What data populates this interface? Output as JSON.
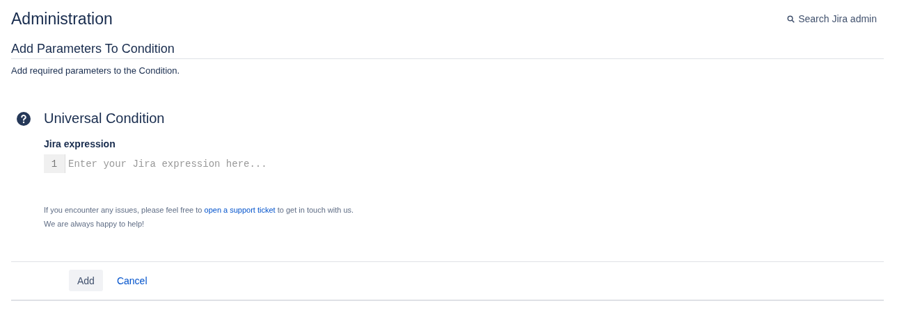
{
  "header": {
    "title": "Administration",
    "search_link": "Search Jira admin"
  },
  "section": {
    "title": "Add Parameters To Condition",
    "description": "Add required parameters to the Condition."
  },
  "condition": {
    "title": "Universal Condition",
    "field_label": "Jira expression",
    "editor": {
      "line_number": "1",
      "placeholder": "Enter your Jira expression here..."
    },
    "help": {
      "before": "If you encounter any issues, please feel free to ",
      "link": "open a support ticket",
      "after": " to get in touch with us.",
      "line_2": "We are always happy to help!"
    }
  },
  "buttons": [
    {
      "kind": "primary",
      "label": "Add"
    },
    {
      "kind": "link",
      "label": "Cancel"
    }
  ]
}
